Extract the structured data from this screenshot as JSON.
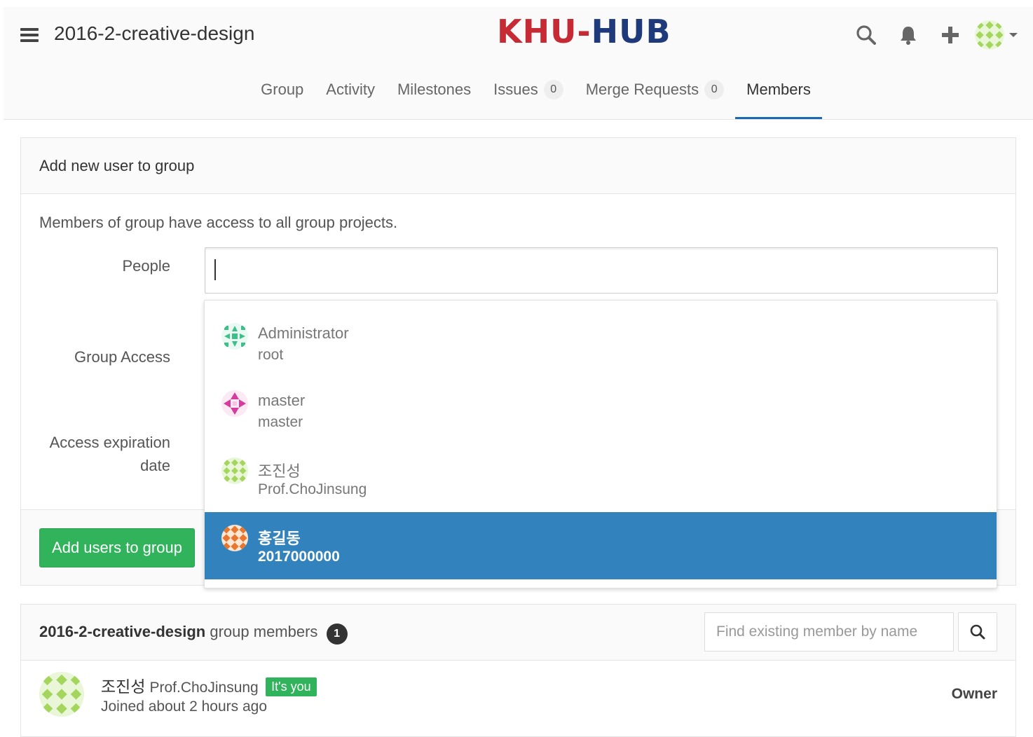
{
  "header": {
    "group_title": "2016-2-creative-design",
    "logo_left": "KHU-",
    "logo_right": "HUB"
  },
  "nav": {
    "tabs": [
      {
        "label": "Group"
      },
      {
        "label": "Activity"
      },
      {
        "label": "Milestones"
      },
      {
        "label": "Issues",
        "count": "0"
      },
      {
        "label": "Merge Requests",
        "count": "0"
      },
      {
        "label": "Members",
        "active": true
      }
    ]
  },
  "add_panel": {
    "heading": "Add new user to group",
    "description": "Members of group have access to all group projects.",
    "people_label": "People",
    "group_access_label": "Group Access",
    "expiration_label_line1": "Access expiration",
    "expiration_label_line2": "date",
    "people_value": "",
    "submit_label": "Add users to group"
  },
  "dropdown": {
    "items": [
      {
        "name": "Administrator",
        "username": "root",
        "avatar_color": "#3dbf8a"
      },
      {
        "name": "master",
        "username": "master",
        "avatar_color": "#d63c9e"
      },
      {
        "name": "조진성",
        "username": "Prof.ChoJinsung",
        "avatar_color": "#a4d65e"
      },
      {
        "name": "홍길동",
        "username": "2017000000",
        "avatar_color": "#e8762c",
        "selected": true
      }
    ]
  },
  "members": {
    "group_name": "2016-2-creative-design",
    "title_suffix": "group members",
    "count": "1",
    "search_placeholder": "Find existing member by name",
    "rows": [
      {
        "name": "조진성",
        "username": "Prof.ChoJinsung",
        "badge": "It's you",
        "joined": "Joined about 2 hours ago",
        "role": "Owner"
      }
    ]
  },
  "colors": {
    "accent": "#1b69b6",
    "success": "#31b35c",
    "selected": "#3182bd"
  }
}
